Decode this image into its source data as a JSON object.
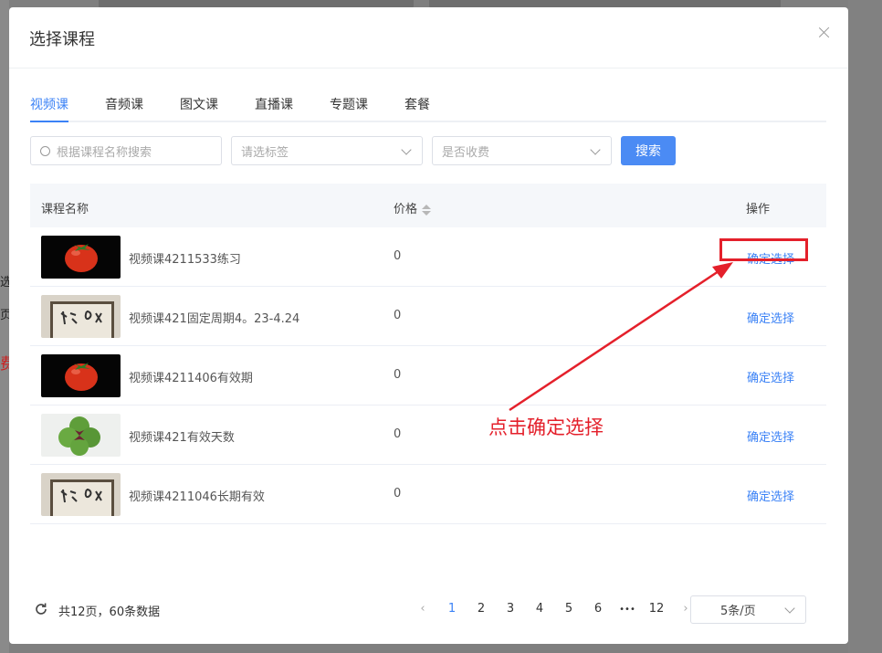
{
  "modal": {
    "title": "选择课程",
    "close_icon": "close-icon"
  },
  "tabs": [
    {
      "label": "视频课",
      "active": true
    },
    {
      "label": "音频课",
      "active": false
    },
    {
      "label": "图文课",
      "active": false
    },
    {
      "label": "直播课",
      "active": false
    },
    {
      "label": "专题课",
      "active": false
    },
    {
      "label": "套餐",
      "active": false
    }
  ],
  "filters": {
    "search_placeholder": "根据课程名称搜索",
    "tag_placeholder": "请选标签",
    "fee_placeholder": "是否收费",
    "search_button": "搜索"
  },
  "table": {
    "columns": {
      "name": "课程名称",
      "price": "价格",
      "action": "操作"
    },
    "rows": [
      {
        "thumb": "tomato",
        "name": "视频课4211533练习",
        "price": "0",
        "action": "确定选择"
      },
      {
        "thumb": "calligraphy",
        "name": "视频课421固定周期4。23-4.24",
        "price": "0",
        "action": "确定选择"
      },
      {
        "thumb": "tomato",
        "name": "视频课4211406有效期",
        "price": "0",
        "action": "确定选择"
      },
      {
        "thumb": "clover",
        "name": "视频课421有效天数",
        "price": "0",
        "action": "确定选择"
      },
      {
        "thumb": "calligraphy",
        "name": "视频课4211046长期有效",
        "price": "0",
        "action": "确定选择"
      }
    ]
  },
  "annotation": {
    "text": "点击确定选择",
    "color": "#e4202b"
  },
  "footer": {
    "total": "共12页，60条数据",
    "pages": [
      "1",
      "2",
      "3",
      "4",
      "5",
      "6",
      "•••",
      "12"
    ],
    "current_page": "1",
    "page_size": "5条/页"
  },
  "colors": {
    "accent": "#3b82f6",
    "button": "#4b8bf4"
  },
  "background": {
    "left_texts": [
      "选",
      "页",
      "费"
    ]
  }
}
